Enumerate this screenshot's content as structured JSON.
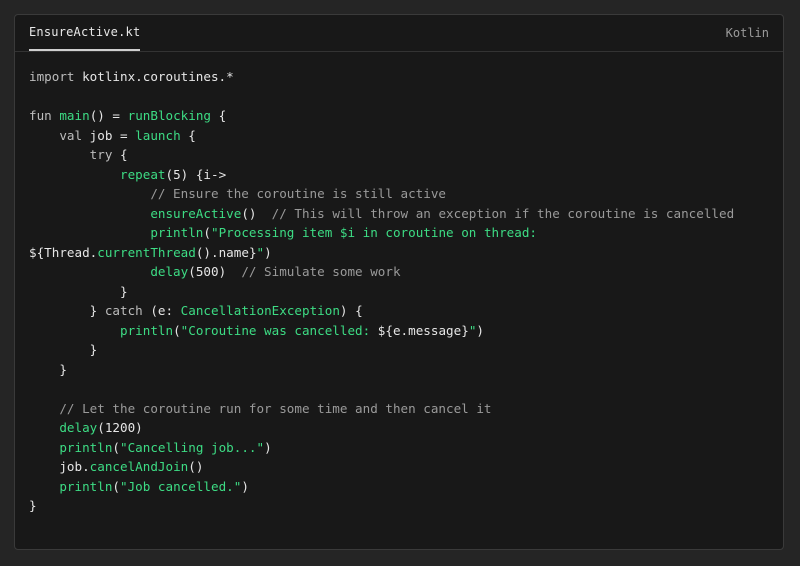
{
  "editor": {
    "tab_label": "EnsureActive.kt",
    "language_label": "Kotlin"
  },
  "colors": {
    "background": "#252525",
    "panel": "#181818",
    "accent_green": "#3ddc84",
    "comment": "#9a9a9a",
    "text": "#e6e6e6"
  },
  "code_lines": [
    [
      [
        "kw",
        "import "
      ],
      [
        "plain",
        "kotlinx.coroutines.*"
      ]
    ],
    [],
    [
      [
        "kw",
        "fun "
      ],
      [
        "fn",
        "main"
      ],
      [
        "punct",
        "() = "
      ],
      [
        "fn",
        "runBlocking"
      ],
      [
        "punct",
        " {"
      ]
    ],
    [
      [
        "kw",
        "    val "
      ],
      [
        "plain",
        "job"
      ],
      [
        "punct",
        " = "
      ],
      [
        "fn",
        "launch"
      ],
      [
        "punct",
        " {"
      ]
    ],
    [
      [
        "kw",
        "        try "
      ],
      [
        "punct",
        "{"
      ]
    ],
    [
      [
        "fn",
        "            repeat"
      ],
      [
        "punct",
        "(5) {"
      ],
      [
        "plain",
        "i"
      ],
      [
        "punct",
        "->"
      ]
    ],
    [
      [
        "com",
        "                // Ensure the coroutine is still active"
      ]
    ],
    [
      [
        "fn",
        "                ensureActive"
      ],
      [
        "punct",
        "()  "
      ],
      [
        "com",
        "// This will throw an exception if the coroutine is cancelled"
      ]
    ],
    [
      [
        "fn",
        "                println"
      ],
      [
        "punct",
        "("
      ],
      [
        "str",
        "\"Processing item $i in coroutine on thread:"
      ]
    ],
    [
      [
        "punct",
        "${"
      ],
      [
        "plain",
        "Thread"
      ],
      [
        "punct",
        "."
      ],
      [
        "fn",
        "currentThread"
      ],
      [
        "punct",
        "()."
      ],
      [
        "plain",
        "name"
      ],
      [
        "punct",
        "}"
      ],
      [
        "str",
        "\""
      ],
      [
        "punct",
        ")"
      ]
    ],
    [
      [
        "fn",
        "                delay"
      ],
      [
        "punct",
        "(500)  "
      ],
      [
        "com",
        "// Simulate some work"
      ]
    ],
    [
      [
        "punct",
        "            }"
      ]
    ],
    [
      [
        "punct",
        "        } "
      ],
      [
        "kw",
        "catch "
      ],
      [
        "punct",
        "(e: "
      ],
      [
        "type",
        "CancellationException"
      ],
      [
        "punct",
        ") {"
      ]
    ],
    [
      [
        "fn",
        "            println"
      ],
      [
        "punct",
        "("
      ],
      [
        "str",
        "\"Coroutine was cancelled: "
      ],
      [
        "punct",
        "${"
      ],
      [
        "plain",
        "e.message"
      ],
      [
        "punct",
        "}"
      ],
      [
        "str",
        "\""
      ],
      [
        "punct",
        ")"
      ]
    ],
    [
      [
        "punct",
        "        }"
      ]
    ],
    [
      [
        "punct",
        "    }"
      ]
    ],
    [],
    [
      [
        "com",
        "    // Let the coroutine run for some time and then cancel it"
      ]
    ],
    [
      [
        "fn",
        "    delay"
      ],
      [
        "punct",
        "(1200)"
      ]
    ],
    [
      [
        "fn",
        "    println"
      ],
      [
        "punct",
        "("
      ],
      [
        "str",
        "\"Cancelling job...\""
      ],
      [
        "punct",
        ")"
      ]
    ],
    [
      [
        "plain",
        "    job"
      ],
      [
        "punct",
        "."
      ],
      [
        "fn",
        "cancelAndJoin"
      ],
      [
        "punct",
        "()"
      ]
    ],
    [
      [
        "fn",
        "    println"
      ],
      [
        "punct",
        "("
      ],
      [
        "str",
        "\"Job cancelled.\""
      ],
      [
        "punct",
        ")"
      ]
    ],
    [
      [
        "punct",
        "}"
      ]
    ]
  ]
}
